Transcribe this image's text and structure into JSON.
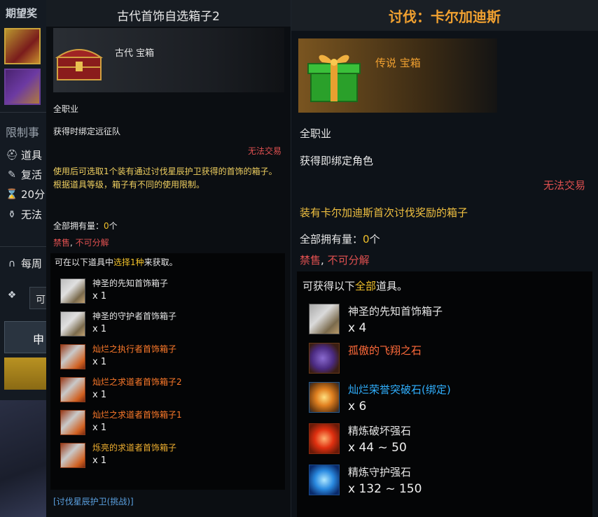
{
  "background": {
    "panel_title": "期望奖",
    "section_title": "限制事",
    "rows": [
      {
        "icon": "helmet-icon",
        "glyph": "⛑",
        "label": "道具"
      },
      {
        "icon": "feather-icon",
        "glyph": "✎",
        "label": "复活"
      },
      {
        "icon": "hourglass-icon",
        "glyph": "⌛",
        "label": "20分"
      },
      {
        "icon": "potion-icon",
        "glyph": "⚱",
        "label": "无法"
      },
      {
        "icon": "magnet-icon",
        "glyph": "∩",
        "label": "每周"
      }
    ],
    "input_value": "可",
    "button_label": "申"
  },
  "left_tooltip": {
    "title": "古代首饰自选箱子2",
    "grade": "古代 宝箱",
    "class_req": "全职业",
    "bind": "获得时绑定远征队",
    "untradable": "无法交易",
    "description": "使用后可选取1个装有通过讨伐星辰护卫获得的首饰的箱子。",
    "description2": "根据道具等级，箱子有不同的使用限制。",
    "owned_label": "全部拥有量：",
    "owned_count": "0",
    "owned_unit": "个",
    "ban_sell": "禁售",
    "ban_sep": ",",
    "ban_disassemble": "不可分解",
    "list_head_pre": "可在以下道具中",
    "list_head_hl": "选择1种",
    "list_head_post": "来获取。",
    "items": [
      {
        "name": "神圣的先知首饰箱子",
        "qty": "x 1"
      },
      {
        "name": "神圣的守护者首饰箱子",
        "qty": "x 1"
      },
      {
        "name": "灿烂之执行者首饰箱子",
        "qty": "x 1"
      },
      {
        "name": "灿烂之求道者首饰箱子2",
        "qty": "x 1"
      },
      {
        "name": "灿烂之求道者首饰箱子1",
        "qty": "x 1"
      },
      {
        "name": "烁亮的求道者首饰箱子",
        "qty": "x 1"
      }
    ],
    "source_link": "[讨伐星辰护卫(挑战)]"
  },
  "right_tooltip": {
    "title": "讨伐：卡尔加迪斯",
    "grade": "传说 宝箱",
    "class_req": "全职业",
    "bind": "获得即绑定角色",
    "untradable": "无法交易",
    "description": "装有卡尔加迪斯首次讨伐奖励的箱子",
    "owned_label": "全部拥有量：",
    "owned_count": "0",
    "owned_unit": "个",
    "ban_sell": "禁售",
    "ban_sep": ",",
    "ban_disassemble": "不可分解",
    "list_head_pre": "可获得以下",
    "list_head_hl": "全部",
    "list_head_post": "道具。",
    "items": [
      {
        "name": "神圣的先知首饰箱子",
        "qty": "x 4"
      },
      {
        "name": "孤傲的飞翔之石",
        "qty": ""
      },
      {
        "name": "灿烂荣誉突破石(绑定)",
        "qty": "x 6"
      },
      {
        "name": "精炼破坏强石",
        "qty": "x 44 ~ 50"
      },
      {
        "name": "精炼守护强石",
        "qty": "x 132 ~ 150"
      }
    ]
  },
  "colors": {
    "grade_orange": "#f0a030",
    "untradable_red": "#e05050",
    "highlight_gold": "#f0c02a",
    "relic_orange": "#ff7a2a",
    "epic_blue": "#30b0ff",
    "link_blue": "#5aa0e0"
  }
}
